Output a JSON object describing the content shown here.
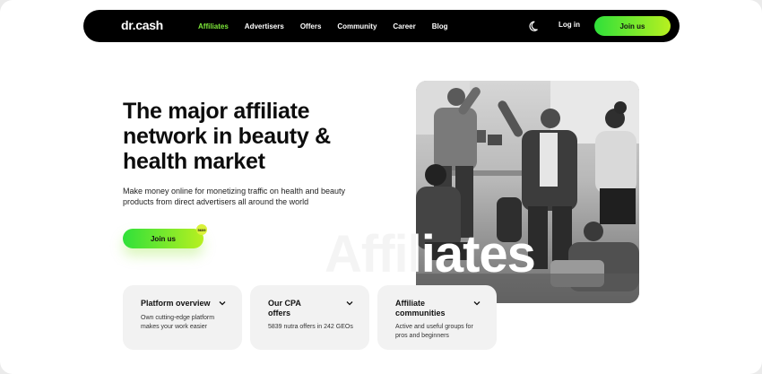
{
  "nav": {
    "logo": "dr.cash",
    "items": [
      {
        "label": "Affiliates",
        "active": true
      },
      {
        "label": "Advertisers",
        "active": false
      },
      {
        "label": "Offers",
        "active": false
      },
      {
        "label": "Community",
        "active": false
      },
      {
        "label": "Career",
        "active": false
      },
      {
        "label": "Blog",
        "active": false
      }
    ],
    "theme_icon": "moon-icon",
    "login_label": "Log in",
    "join_label": "Join us"
  },
  "hero": {
    "title": "The major affiliate network in beauty & health market",
    "subtitle": "Make money online for monetizing traffic on health and beauty products from direct advertisers all around the world",
    "join_label": "Join us",
    "badge": "5609",
    "overlay_word": "Affiliates"
  },
  "cards": [
    {
      "title": "Platform overview",
      "desc": "Own cutting-edge platform makes your work easier"
    },
    {
      "title": "Our CPA offers",
      "desc": "5839 nutra offers in 242 GEOs"
    },
    {
      "title": "Affiliate communities",
      "desc": "Active and useful groups for pros and beginners"
    }
  ],
  "colors": {
    "accent_green": "#7ee83a",
    "gradient_start": "#2fe03a",
    "gradient_end": "#b8f020",
    "nav_bg": "#000000"
  }
}
